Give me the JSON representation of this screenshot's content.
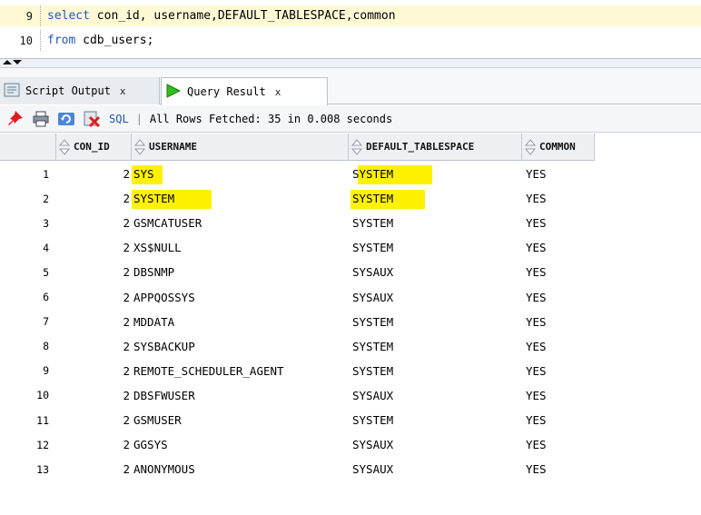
{
  "editor": {
    "lines": [
      {
        "number": "9",
        "keyword": "select",
        "rest": " con_id, username,DEFAULT_TABLESPACE,common"
      },
      {
        "number": "10",
        "keyword": "from",
        "rest": " cdb_users;"
      }
    ]
  },
  "tabs": [
    {
      "label": "Script Output",
      "close": "x",
      "icon": "script-output-icon"
    },
    {
      "label": "Query Result",
      "close": "x",
      "icon": "run-arrow-icon"
    }
  ],
  "toolbar": {
    "sql_label": "SQL",
    "separator": "|",
    "status": "All Rows Fetched: 35 in 0.008 seconds",
    "icons": [
      "pin-icon",
      "print-icon",
      "refresh-icon",
      "export-icon"
    ]
  },
  "grid": {
    "columns": [
      "CON_ID",
      "USERNAME",
      "DEFAULT_TABLESPACE",
      "COMMON"
    ],
    "rows": [
      {
        "num": "1",
        "con_id": "2",
        "username": "SYS",
        "tablespace": "SYSTEM",
        "common": "YES"
      },
      {
        "num": "2",
        "con_id": "2",
        "username": "SYSTEM",
        "tablespace": "SYSTEM",
        "common": "YES"
      },
      {
        "num": "3",
        "con_id": "2",
        "username": "GSMCATUSER",
        "tablespace": "SYSTEM",
        "common": "YES"
      },
      {
        "num": "4",
        "con_id": "2",
        "username": "XS$NULL",
        "tablespace": "SYSTEM",
        "common": "YES"
      },
      {
        "num": "5",
        "con_id": "2",
        "username": "DBSNMP",
        "tablespace": "SYSAUX",
        "common": "YES"
      },
      {
        "num": "6",
        "con_id": "2",
        "username": "APPQOSSYS",
        "tablespace": "SYSAUX",
        "common": "YES"
      },
      {
        "num": "7",
        "con_id": "2",
        "username": "MDDATA",
        "tablespace": "SYSTEM",
        "common": "YES"
      },
      {
        "num": "8",
        "con_id": "2",
        "username": "SYSBACKUP",
        "tablespace": "SYSTEM",
        "common": "YES"
      },
      {
        "num": "9",
        "con_id": "2",
        "username": "REMOTE_SCHEDULER_AGENT",
        "tablespace": "SYSTEM",
        "common": "YES"
      },
      {
        "num": "10",
        "con_id": "2",
        "username": "DBSFWUSER",
        "tablespace": "SYSAUX",
        "common": "YES"
      },
      {
        "num": "11",
        "con_id": "2",
        "username": "GSMUSER",
        "tablespace": "SYSTEM",
        "common": "YES"
      },
      {
        "num": "12",
        "con_id": "2",
        "username": "GGSYS",
        "tablespace": "SYSAUX",
        "common": "YES"
      },
      {
        "num": "13",
        "con_id": "2",
        "username": "ANONYMOUS",
        "tablespace": "SYSAUX",
        "common": "YES"
      }
    ]
  },
  "colors": {
    "keyword": "#1f57b5",
    "highlight": "#fff200",
    "run_arrow": "#2fbf1f",
    "current_line": "#fff9d6"
  }
}
